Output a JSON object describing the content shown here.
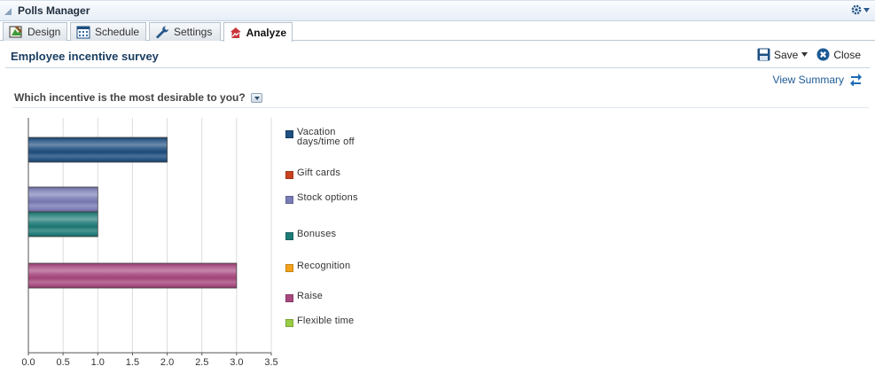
{
  "app": {
    "title": "Polls Manager"
  },
  "tabs": [
    {
      "label": "Design",
      "icon": "design-icon"
    },
    {
      "label": "Schedule",
      "icon": "calendar-icon"
    },
    {
      "label": "Settings",
      "icon": "wrench-icon"
    },
    {
      "label": "Analyze",
      "icon": "analyze-icon",
      "active": true
    }
  ],
  "survey": {
    "title": "Employee incentive survey"
  },
  "actions": {
    "save_label": "Save",
    "close_label": "Close",
    "view_summary_label": "View Summary"
  },
  "question": {
    "text": "Which incentive is the most desirable to you?"
  },
  "chart_data": {
    "type": "bar",
    "orientation": "horizontal",
    "categories": [
      "Vacation days/time off",
      "Gift cards",
      "Stock options",
      "Bonuses",
      "Recognition",
      "Raise",
      "Flexible time"
    ],
    "values": [
      2,
      0,
      1,
      1,
      0,
      3,
      0
    ],
    "colors": [
      "#1f4e80",
      "#c8421f",
      "#7a7cb6",
      "#1d7b77",
      "#f5a21a",
      "#a8487f",
      "#9acd45"
    ],
    "xlim": [
      0,
      3.5
    ],
    "xticks": [
      "0.0",
      "0.5",
      "1.0",
      "1.5",
      "2.0",
      "2.5",
      "3.0",
      "3.5"
    ],
    "grid": true,
    "legend_position": "right"
  }
}
